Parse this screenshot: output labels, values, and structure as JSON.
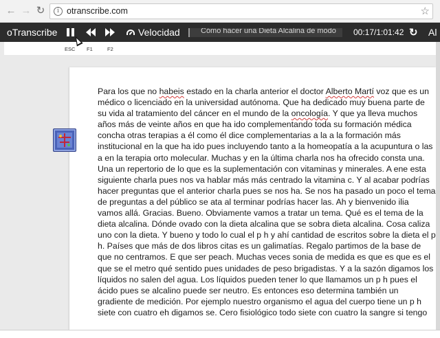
{
  "browser": {
    "url": "otranscribe.com",
    "info_icon": "info-icon",
    "bookmark_icon": "star-icon"
  },
  "toolbar": {
    "brand": "oTranscribe",
    "speed_label": "Velocidad",
    "media_title": "Cómo hacer una Dieta Alcalina de modo",
    "timecode": "00:17/1:01:42",
    "overflow_label": "Al",
    "hints": {
      "pause": "ESC",
      "rewind": "F1",
      "forward": "F2"
    },
    "colors": {
      "bar": "#2c2c2c",
      "text": "#ffffff"
    }
  },
  "transcript": {
    "lines": [
      [
        "Para los que no ",
        {
          "t": "habeis",
          "sp": true
        },
        " estado en la charla anterior el doctor ",
        {
          "t": "Alberto Martí",
          "sp": true
        },
        " voz que es un"
      ],
      [
        "médico o licenciado en la universidad autónoma. Que ha dedicado muy buena parte de"
      ],
      [
        "su vida al tratamiento del cáncer en el mundo de la ",
        {
          "t": "oncología",
          "sp": true
        },
        ". Y que ya lleva muchos"
      ],
      [
        "años más de veinte años en que ha ido complementando toda su formación médica"
      ],
      [
        "concha otras terapias a él como él dice complementarias a la a la formación más"
      ],
      [
        "institucional en la que ha ido pues incluyendo tanto a la homeopatía a la acupuntura o las"
      ],
      [
        "a en la terapia orto molecular. Muchas y en la última charla nos ha ofrecido consta una."
      ],
      [
        "Una un repertorio de lo que es la suplementación con vitaminas y minerales. A ene esta"
      ],
      [
        "siguiente charla pues nos va hablar más más centrado la vitamina c. Y al acabar podrías"
      ],
      [
        "hacer preguntas que el anterior charla pues se nos ha. Se nos ha pasado un poco el tema"
      ],
      [
        "de preguntas a del público se ata al terminar podrías hacer las. Ah y bienvenido ilia"
      ],
      [
        "vamos allá. Gracias. Bueno. Obviamente vamos a tratar un tema. Qué es el tema de la"
      ],
      [
        "dieta alcalina. Dónde ovado con la dieta alcalina que se sobra dieta alcalina. Cosa caliza"
      ],
      [
        "uno con la dieta. Y bueno y todo lo cual el p h y ahí cantidad de escritos sobre la dieta el p"
      ],
      [
        "h. Países que más de dos libros citas es un galimatías. Regalo partimos de la base de"
      ],
      [
        "que no centramos. E que ser peach. Muchas veces sonia de medida es que es que es el"
      ],
      [
        "que se el metro qué sentido pues unidades de peso brigadistas. Y a la sazón digamos los"
      ],
      [
        "líquidos no salen del agua. Los líquidos pueden tener lo que llamamos un p h pues el"
      ],
      [
        "ácido pues se alcalino puede ser neutro. Es entonces eso determina también un"
      ],
      [
        "gradiente de medición. Por ejemplo nuestro organismo el agua del cuerpo tiene un p h"
      ],
      [
        "siete con cuatro eh digamos se. Cero fisiológico todo siete con cuatro la sangre si tengo"
      ]
    ]
  }
}
